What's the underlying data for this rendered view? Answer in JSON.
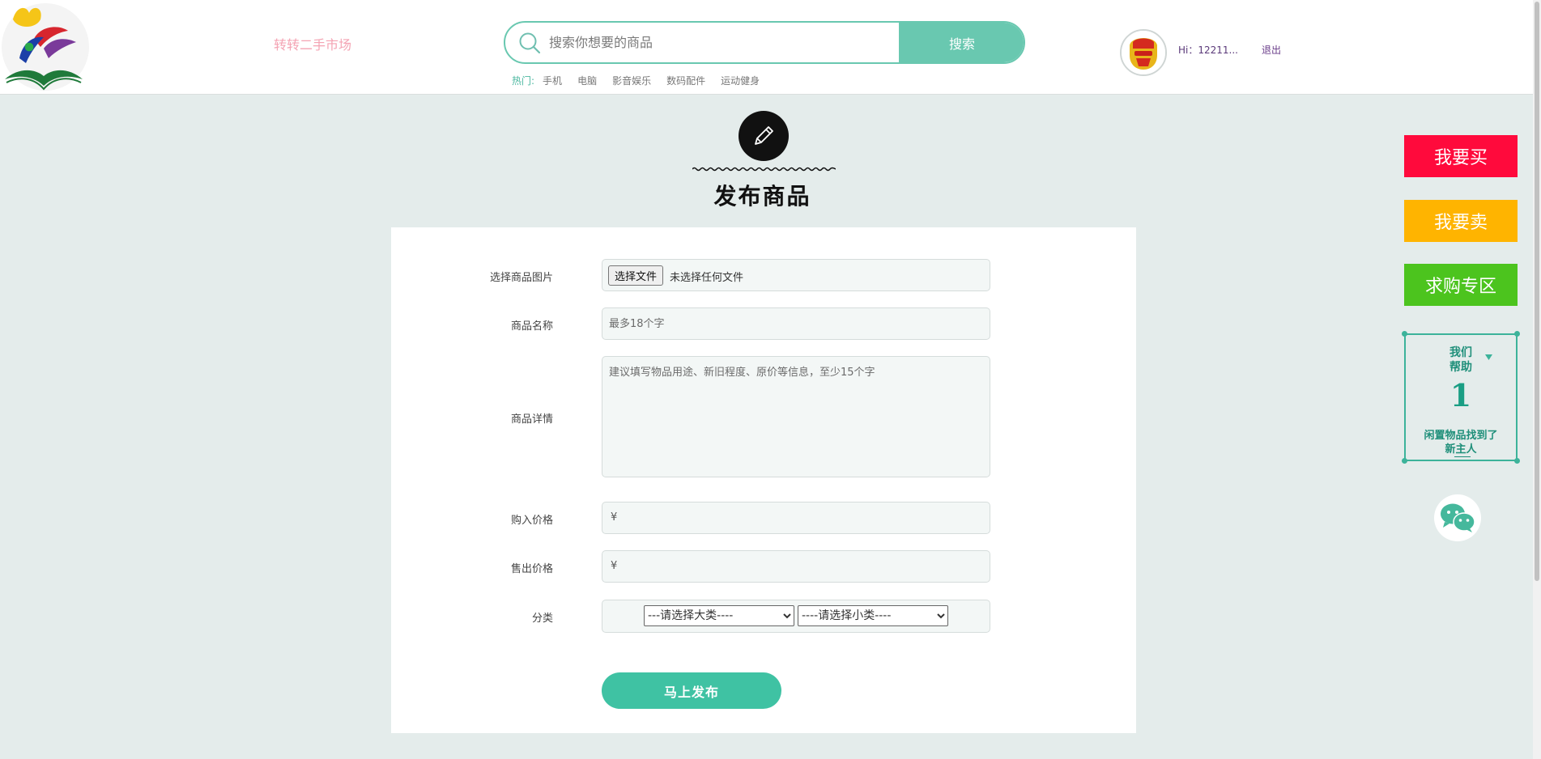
{
  "header": {
    "site_name": "转转二手市场",
    "search": {
      "placeholder": "搜索你想要的商品",
      "button_label": "搜索"
    },
    "hot": {
      "label": "热门:",
      "items": [
        "手机",
        "电脑",
        "影音娱乐",
        "数码配件",
        "运动健身"
      ]
    },
    "user": {
      "greeting": "Hi：12211...",
      "logout_label": "退出"
    }
  },
  "page": {
    "title": "发布商品"
  },
  "form": {
    "image": {
      "label": "选择商品图片",
      "button_label": "选择文件",
      "status": "未选择任何文件"
    },
    "name": {
      "label": "商品名称",
      "placeholder": "最多18个字"
    },
    "detail": {
      "label": "商品详情",
      "placeholder": "建议填写物品用途、新旧程度、原价等信息，至少15个字"
    },
    "buy_price": {
      "label": "购入价格",
      "currency": "¥"
    },
    "sell_price": {
      "label": "售出价格",
      "currency": "¥"
    },
    "category": {
      "label": "分类",
      "major_selected": "---请选择大类----",
      "minor_selected": "----请选择小类----"
    },
    "submit_label": "马上发布"
  },
  "sidebar": {
    "buy_label": "我要买",
    "sell_label": "我要卖",
    "wanted_label": "求购专区",
    "help": {
      "line1": "我们",
      "line2": "帮助",
      "count": "1",
      "line3": "闲置物品找到了",
      "line4": "新主人"
    },
    "colors": {
      "buy": "#ff0a3c",
      "sell": "#ffb400",
      "wanted": "#4cc41e",
      "help_border": "#3cb39a"
    }
  },
  "colors": {
    "accent": "#69c8b0",
    "submit": "#3fc2a3",
    "page_bg": "#e4eceb"
  }
}
